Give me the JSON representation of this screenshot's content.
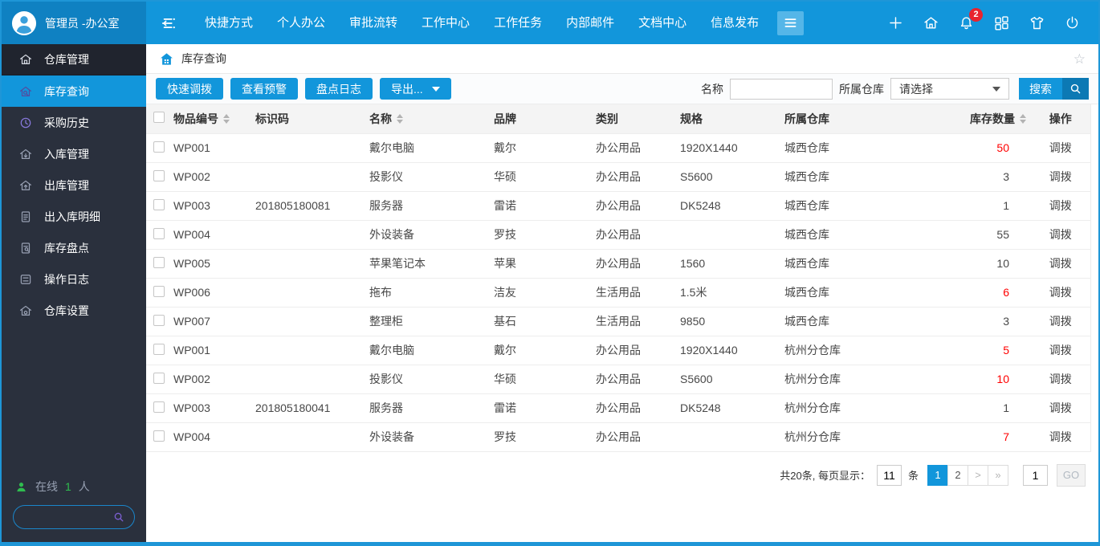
{
  "theme": {
    "accent": "#1296db",
    "accent_dark": "#0c79b4",
    "user_section_bg": "#0f81c2",
    "sidebar_bg": "#2a303d",
    "warning_red": "#ff0000",
    "online_green": "#2fbd4f"
  },
  "navbar": {
    "user_name": "管理员 -办公室",
    "menu": [
      "快捷方式",
      "个人办公",
      "审批流转",
      "工作中心",
      "工作任务",
      "内部邮件",
      "文档中心",
      "信息发布"
    ],
    "notification_count": "2",
    "right_icons": [
      "plus",
      "home",
      "bell",
      "apps",
      "tshirt",
      "power"
    ]
  },
  "sidebar": {
    "items": [
      {
        "label": "仓库管理",
        "icon": "warehouse",
        "type": "header"
      },
      {
        "label": "库存查询",
        "icon": "inventory-search",
        "type": "active"
      },
      {
        "label": "采购历史",
        "icon": "history-clock",
        "type": "normal"
      },
      {
        "label": "入库管理",
        "icon": "inbound",
        "type": "normal"
      },
      {
        "label": "出库管理",
        "icon": "outbound",
        "type": "normal"
      },
      {
        "label": "出入库明细",
        "icon": "detail-doc",
        "type": "normal"
      },
      {
        "label": "库存盘点",
        "icon": "stocktake-doc",
        "type": "normal"
      },
      {
        "label": "操作日志",
        "icon": "log-list",
        "type": "normal"
      },
      {
        "label": "仓库设置",
        "icon": "warehouse-settings",
        "type": "normal"
      }
    ],
    "online_label": "在线",
    "online_count": "1",
    "online_suffix": "人",
    "search_value": ""
  },
  "breadcrumb": {
    "title": "库存查询"
  },
  "toolbar": {
    "buttons": [
      "快速调拨",
      "查看预警",
      "盘点日志"
    ],
    "export_label": "导出...",
    "name_label": "名称",
    "name_value": "",
    "warehouse_label": "所属仓库",
    "warehouse_selected": "请选择",
    "search_label": "搜索"
  },
  "table": {
    "columns": [
      {
        "label": "物品编号",
        "sortable": true
      },
      {
        "label": "标识码",
        "sortable": false
      },
      {
        "label": "名称",
        "sortable": true
      },
      {
        "label": "品牌",
        "sortable": false
      },
      {
        "label": "类别",
        "sortable": false
      },
      {
        "label": "规格",
        "sortable": false
      },
      {
        "label": "所属仓库",
        "sortable": false
      },
      {
        "label": "库存数量",
        "sortable": true
      },
      {
        "label": "操作",
        "sortable": false
      }
    ],
    "rows": [
      {
        "code": "WP001",
        "sn": "",
        "name": "戴尔电脑",
        "brand": "戴尔",
        "category": "办公用品",
        "spec": "1920X1440",
        "warehouse": "城西仓库",
        "qty": "50",
        "qty_red": true,
        "action": "调拨"
      },
      {
        "code": "WP002",
        "sn": "",
        "name": "投影仪",
        "brand": "华硕",
        "category": "办公用品",
        "spec": "S5600",
        "warehouse": "城西仓库",
        "qty": "3",
        "qty_red": false,
        "action": "调拨"
      },
      {
        "code": "WP003",
        "sn": "201805180081",
        "name": "服务器",
        "brand": "雷诺",
        "category": "办公用品",
        "spec": "DK5248",
        "warehouse": "城西仓库",
        "qty": "1",
        "qty_red": false,
        "action": "调拨"
      },
      {
        "code": "WP004",
        "sn": "",
        "name": "外设装备",
        "brand": "罗技",
        "category": "办公用品",
        "spec": "",
        "warehouse": "城西仓库",
        "qty": "55",
        "qty_red": false,
        "action": "调拨"
      },
      {
        "code": "WP005",
        "sn": "",
        "name": "苹果笔记本",
        "brand": "苹果",
        "category": "办公用品",
        "spec": "1560",
        "warehouse": "城西仓库",
        "qty": "10",
        "qty_red": false,
        "action": "调拨"
      },
      {
        "code": "WP006",
        "sn": "",
        "name": "拖布",
        "brand": "洁友",
        "category": "生活用品",
        "spec": "1.5米",
        "warehouse": "城西仓库",
        "qty": "6",
        "qty_red": true,
        "action": "调拨"
      },
      {
        "code": "WP007",
        "sn": "",
        "name": "整理柜",
        "brand": "基石",
        "category": "生活用品",
        "spec": "9850",
        "warehouse": "城西仓库",
        "qty": "3",
        "qty_red": false,
        "action": "调拨"
      },
      {
        "code": "WP001",
        "sn": "",
        "name": "戴尔电脑",
        "brand": "戴尔",
        "category": "办公用品",
        "spec": "1920X1440",
        "warehouse": "杭州分仓库",
        "qty": "5",
        "qty_red": true,
        "action": "调拨"
      },
      {
        "code": "WP002",
        "sn": "",
        "name": "投影仪",
        "brand": "华硕",
        "category": "办公用品",
        "spec": "S5600",
        "warehouse": "杭州分仓库",
        "qty": "10",
        "qty_red": true,
        "action": "调拨"
      },
      {
        "code": "WP003",
        "sn": "201805180041",
        "name": "服务器",
        "brand": "雷诺",
        "category": "办公用品",
        "spec": "DK5248",
        "warehouse": "杭州分仓库",
        "qty": "1",
        "qty_red": false,
        "action": "调拨"
      },
      {
        "code": "WP004",
        "sn": "",
        "name": "外设装备",
        "brand": "罗技",
        "category": "办公用品",
        "spec": "",
        "warehouse": "杭州分仓库",
        "qty": "7",
        "qty_red": true,
        "action": "调拨"
      }
    ]
  },
  "pagination": {
    "summary": "共20条, 每页显示：",
    "page_size": "11",
    "unit": "条",
    "pages": [
      "1",
      "2"
    ],
    "active_page": "1",
    "next_label": ">",
    "last_label": "»",
    "goto_value": "1",
    "go_label": "GO"
  }
}
